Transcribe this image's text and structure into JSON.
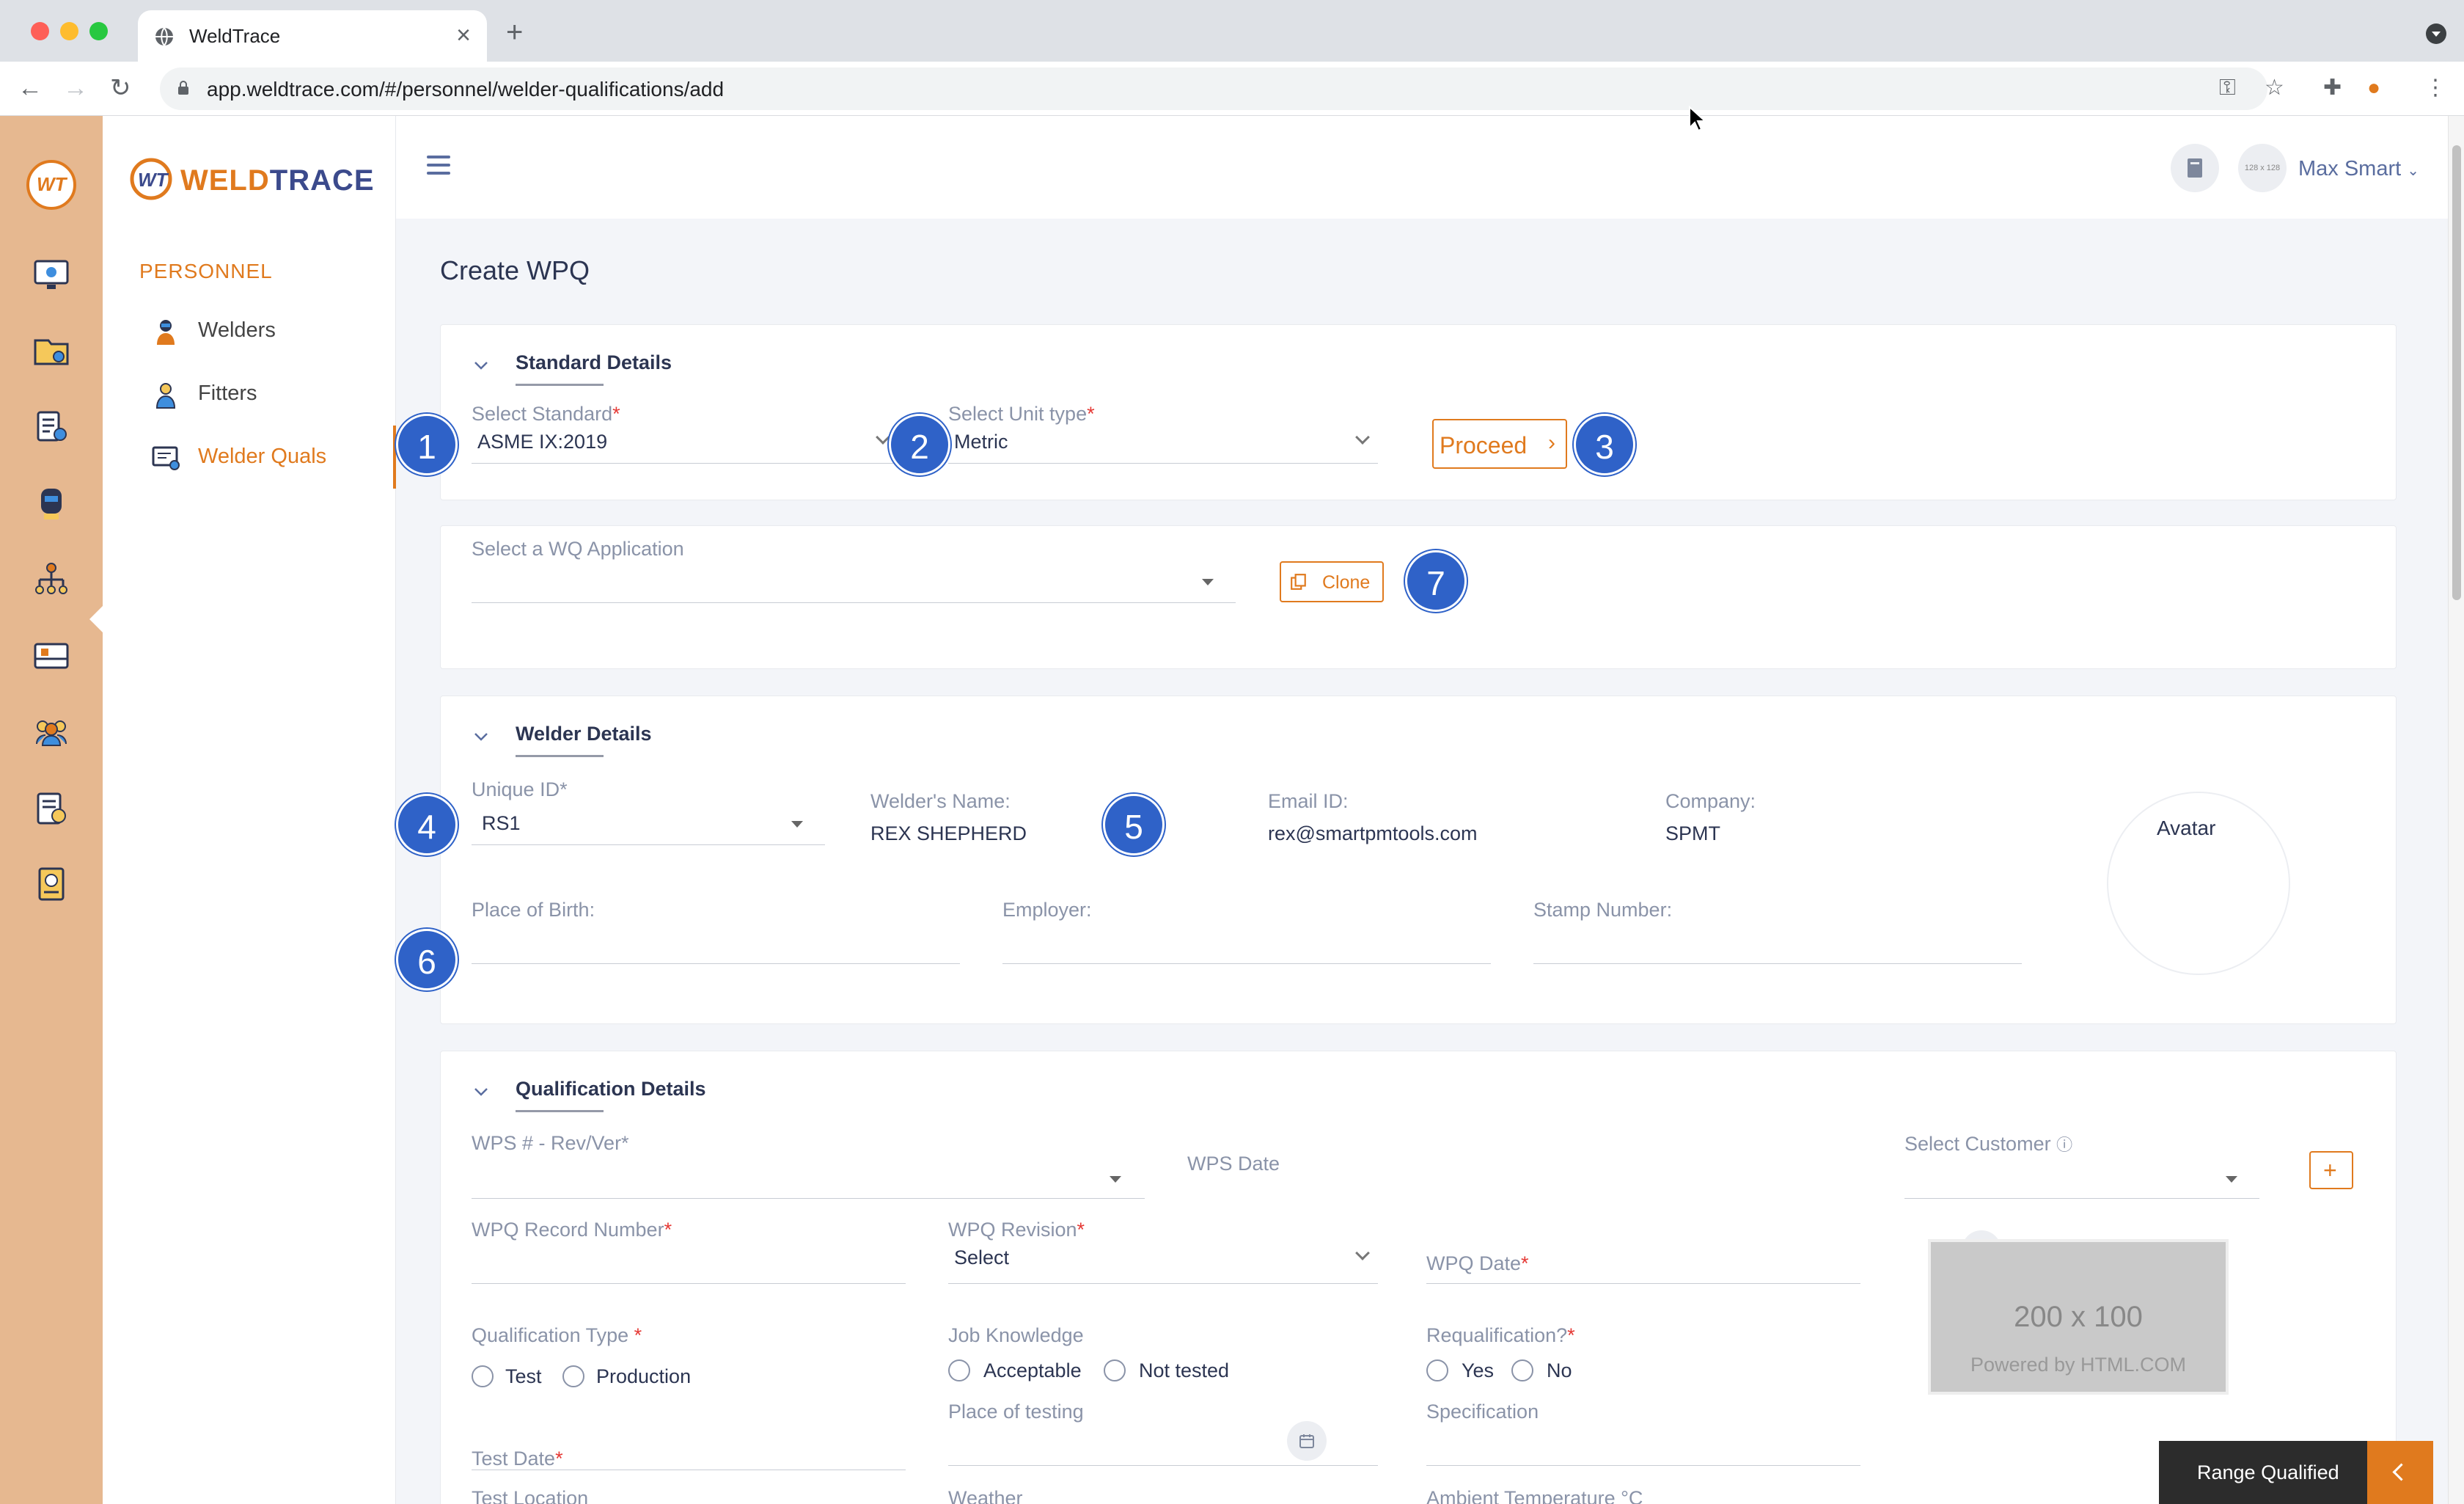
{
  "browser": {
    "tab_title": "WeldTrace",
    "url": "app.weldtrace.com/#/personnel/welder-qualifications/add"
  },
  "brand": {
    "name_prefix": "WELD",
    "name_suffix": "TRACE",
    "rail_logo": "WT"
  },
  "sidebar": {
    "section": "PERSONNEL",
    "items": [
      {
        "label": "Welders",
        "icon": "welder-icon"
      },
      {
        "label": "Fitters",
        "icon": "fitter-icon"
      },
      {
        "label": "Welder Quals",
        "icon": "qualification-icon"
      }
    ],
    "active_index": 2
  },
  "header": {
    "user_name": "Max Smart",
    "avatar_text": "128 x 128"
  },
  "page": {
    "title": "Create WPQ"
  },
  "standard_details": {
    "title": "Standard Details",
    "standard_label": "Select Standard",
    "standard_value": "ASME IX:2019",
    "unit_label": "Select Unit type",
    "unit_value": "Metric",
    "proceed_label": "Proceed"
  },
  "wq_application": {
    "label": "Select a WQ Application",
    "clone_label": "Clone"
  },
  "welder_details": {
    "title": "Welder Details",
    "unique_id_label": "Unique ID*",
    "unique_id_value": "RS1",
    "name_label": "Welder's Name:",
    "name_value": "REX SHEPHERD",
    "email_label": "Email ID:",
    "email_value": "rex@smartpmtools.com",
    "company_label": "Company:",
    "company_value": "SPMT",
    "avatar_alt": "Avatar",
    "place_of_birth_label": "Place of Birth:",
    "employer_label": "Employer:",
    "stamp_label": "Stamp Number:"
  },
  "qualification_details": {
    "title": "Qualification Details",
    "wps_label": "WPS # - Rev/Ver*",
    "wps_date_label": "WPS Date",
    "customer_label": "Select Customer",
    "record_number_label": "WPQ Record Number",
    "revision_label": "WPQ Revision",
    "revision_value": "Select",
    "wpq_date_label": "WPQ Date",
    "qual_type_label": "Qualification Type ",
    "qual_type_options": [
      "Test",
      "Production"
    ],
    "job_knowledge_label": "Job Knowledge",
    "job_knowledge_options": [
      "Acceptable",
      "Not tested"
    ],
    "requal_label": "Requalification?",
    "requal_options": [
      "Yes",
      "No"
    ],
    "image_placeholder": "200 x 100",
    "image_credit": "Powered by HTML.COM",
    "test_date_label": "Test Date",
    "place_of_testing_label": "Place of testing",
    "specification_label": "Specification",
    "test_location_label": "Test Location",
    "weather_label": "Weather",
    "ambient_temp_label": "Ambient Temperature °C"
  },
  "badges": [
    "1",
    "2",
    "3",
    "4",
    "5",
    "6",
    "7"
  ],
  "range_qualified": {
    "label": "Range Qualified"
  },
  "colors": {
    "accent": "#e07a1e",
    "navy": "#2c3552",
    "badge": "#2f62c8",
    "rail": "#e6b890"
  }
}
